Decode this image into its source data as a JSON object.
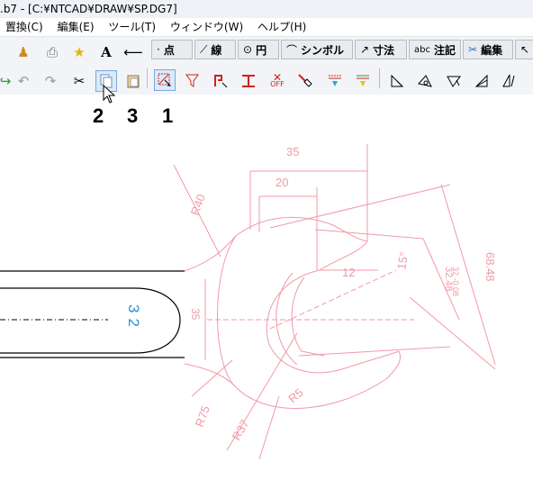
{
  "window": {
    "title": ".b7 - [C:¥NTCAD¥DRAW¥SP.DG7]"
  },
  "menu": [
    {
      "label": "置換(C)"
    },
    {
      "label": "編集(E)"
    },
    {
      "label": "ツール(T)"
    },
    {
      "label": "ウィンドウ(W)"
    },
    {
      "label": "ヘルプ(H)"
    }
  ],
  "toolbar1": {
    "text_tool": "A",
    "tabs": [
      {
        "icon": "·",
        "label": "点"
      },
      {
        "icon": "⟋",
        "label": "線"
      },
      {
        "icon": "⊙",
        "label": "円"
      },
      {
        "icon": "⌒",
        "label": "シンボル"
      },
      {
        "icon": "↗",
        "label": "寸法"
      },
      {
        "icon": "abc",
        "label": "注記"
      },
      {
        "icon": "✂",
        "label": "編集"
      }
    ]
  },
  "toolbar2": {
    "snap_off_label": "OFF"
  },
  "annotations": {
    "n1": "1",
    "n2": "2",
    "n3": "3"
  },
  "drawing": {
    "dims": {
      "d35": "35",
      "d20": "20",
      "d12": "12",
      "d15": "15°",
      "r40": "R40",
      "r75": "R75",
      "r37": "R37",
      "r5": "R5",
      "d3248": "32.48",
      "d3248tol": "32 -0.08",
      "d6848": "68.48",
      "d35v": "35",
      "d32": "32"
    }
  },
  "colors": {
    "dimension": "#f09aa8",
    "outline": "#000000",
    "text_blue": "#2a8fd6",
    "accent_red": "#cc2222"
  }
}
